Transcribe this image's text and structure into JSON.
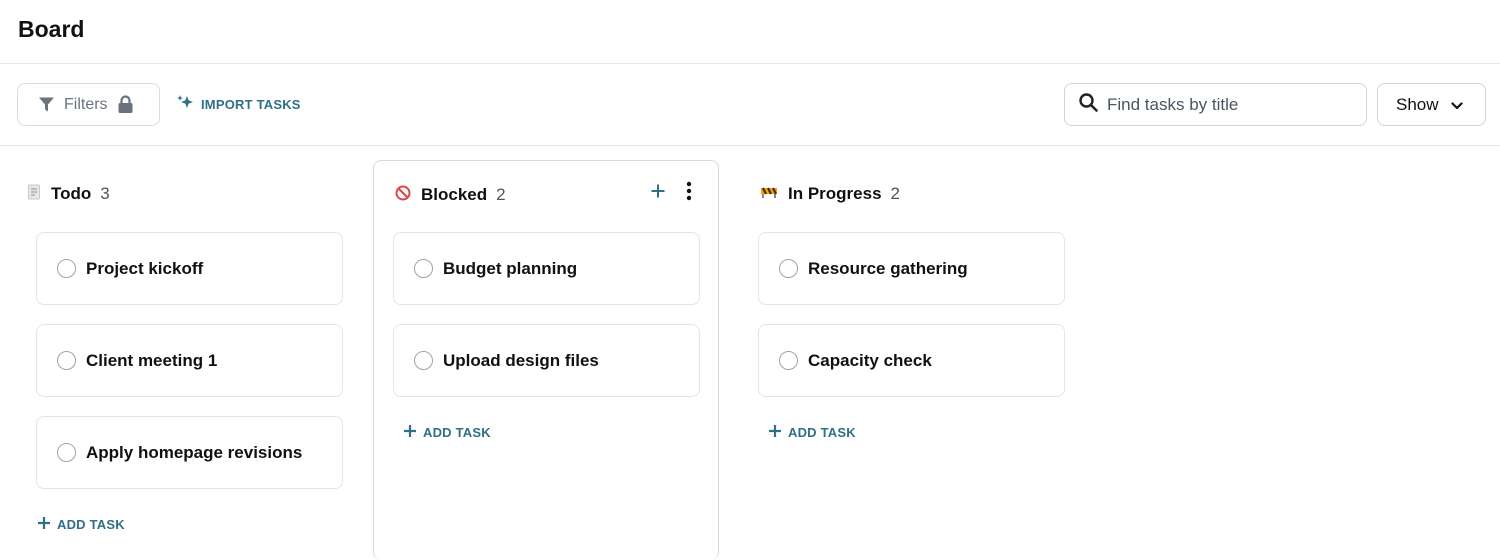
{
  "page": {
    "title": "Board"
  },
  "toolbar": {
    "filters_label": "Filters",
    "import_label": "IMPORT TASKS",
    "search_placeholder": "Find tasks by title",
    "show_label": "Show"
  },
  "colors": {
    "accent": "#2f6f87",
    "blocked": "#e0434b"
  },
  "columns": [
    {
      "name": "Todo",
      "count": "3",
      "icon": "memo-icon",
      "tasks": [
        "Project kickoff",
        "Client meeting 1",
        "Apply homepage revisions"
      ],
      "add_label": "ADD TASK"
    },
    {
      "name": "Blocked",
      "count": "2",
      "icon": "no-entry-icon",
      "tasks": [
        "Budget planning",
        "Upload design files"
      ],
      "add_label": "ADD TASK"
    },
    {
      "name": "In Progress",
      "count": "2",
      "icon": "construction-barrier-icon",
      "tasks": [
        "Resource gathering",
        "Capacity check"
      ],
      "add_label": "ADD TASK"
    }
  ]
}
